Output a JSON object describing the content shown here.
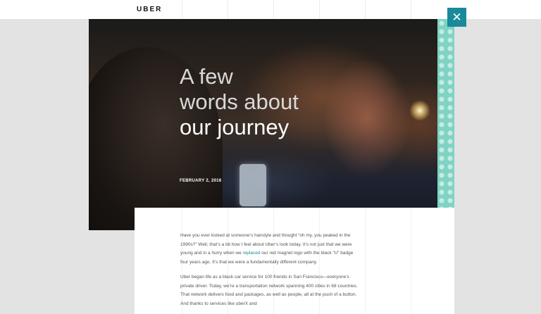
{
  "header": {
    "logo": "UBER"
  },
  "close_icon": {
    "glyph": "✕"
  },
  "hero": {
    "title_line1": "A few",
    "title_line2": "words about",
    "title_line3": "our journey",
    "date": "FEBRUARY 2, 2016"
  },
  "article": {
    "p1_before": "Have you ever looked at someone’s hairstyle and thought “oh my, you peaked in the 1990s?” Well, that’s a bit how I feel about Uber’s look today. It’s not just that we were young and in a hurry when we ",
    "p1_link": "replaced",
    "p1_after": " our red magnet logo with the black “U” badge four years ago. It’s that we were a fundamentally different company.",
    "p2": "Uber began life as a black car service for 100 friends in San Francisco—everyone’s private driver. Today, we’re a transportation network spanning 400 cities in 68 countries. That network delivers food and packages, as well as people, all at the push of a button. And thanks to services like uberX and"
  },
  "colors": {
    "accent": "#1a8a9a",
    "pattern": "#7fd3c2"
  }
}
